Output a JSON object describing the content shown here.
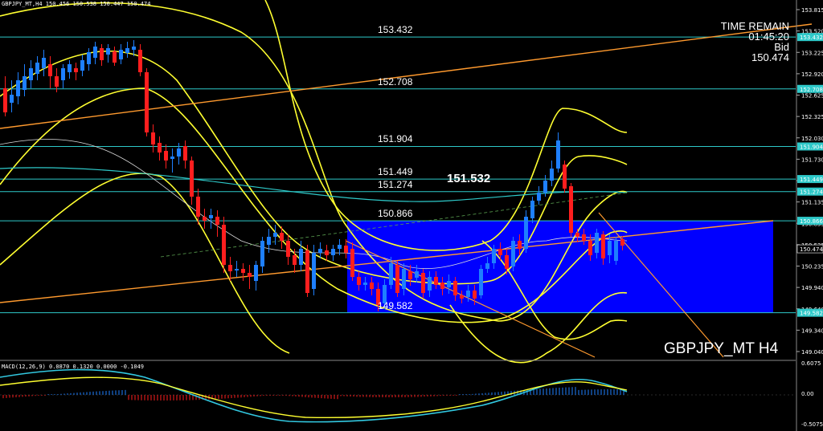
{
  "window": {
    "info_line": "GBPJPY_MT,H4  150.456 150.538 150.447 150.474",
    "symbol_tag": "GBPJPY_MT H4"
  },
  "time_remain": {
    "label": "TIME REMAIN",
    "value": "01:45:20",
    "bid_label": "Bid",
    "bid_value": "150.474"
  },
  "current_price_label": "151.532",
  "levels": [
    {
      "name": "level-153432",
      "label": "153.432",
      "price": 153.432,
      "axis": "153.432"
    },
    {
      "name": "level-152708",
      "label": "152.708",
      "price": 152.708,
      "axis": "152.708"
    },
    {
      "name": "level-151904",
      "label": "151.904",
      "price": 151.904,
      "axis": "151.904"
    },
    {
      "name": "level-151449",
      "label": "151.449",
      "price": 151.449,
      "axis": "151.449"
    },
    {
      "name": "level-151274",
      "label": "151.274",
      "price": 151.274,
      "axis": "151.274"
    },
    {
      "name": "level-150866",
      "label": "150.866",
      "price": 150.866,
      "axis": "150.866"
    },
    {
      "name": "level-149582",
      "label": "149.582",
      "price": 149.582,
      "axis": "149.582"
    }
  ],
  "price_axis": {
    "ticks": [
      "153.815",
      "153.520",
      "153.225",
      "152.920",
      "152.625",
      "152.325",
      "152.030",
      "151.730",
      "151.435",
      "151.135",
      "150.835",
      "150.535",
      "150.235",
      "149.940",
      "149.640",
      "149.340",
      "149.040"
    ],
    "current_value": "150.474",
    "ylim": [
      148.88,
      153.98
    ]
  },
  "macd": {
    "label": "MACD(12,26,9) 0.0870 0.1320 0.0000 -0.1049",
    "axis_ticks": [
      "0.6075",
      "0.00",
      "-0.5075"
    ]
  },
  "colors": {
    "background": "#000000",
    "bull": "#1e7fff",
    "bear": "#ff1e1e",
    "band": "#ffff30",
    "level_line": "#2ec9c9",
    "channel": "#ff9a2e",
    "zone": "#0000ff",
    "signal": "#32c8e0"
  }
}
